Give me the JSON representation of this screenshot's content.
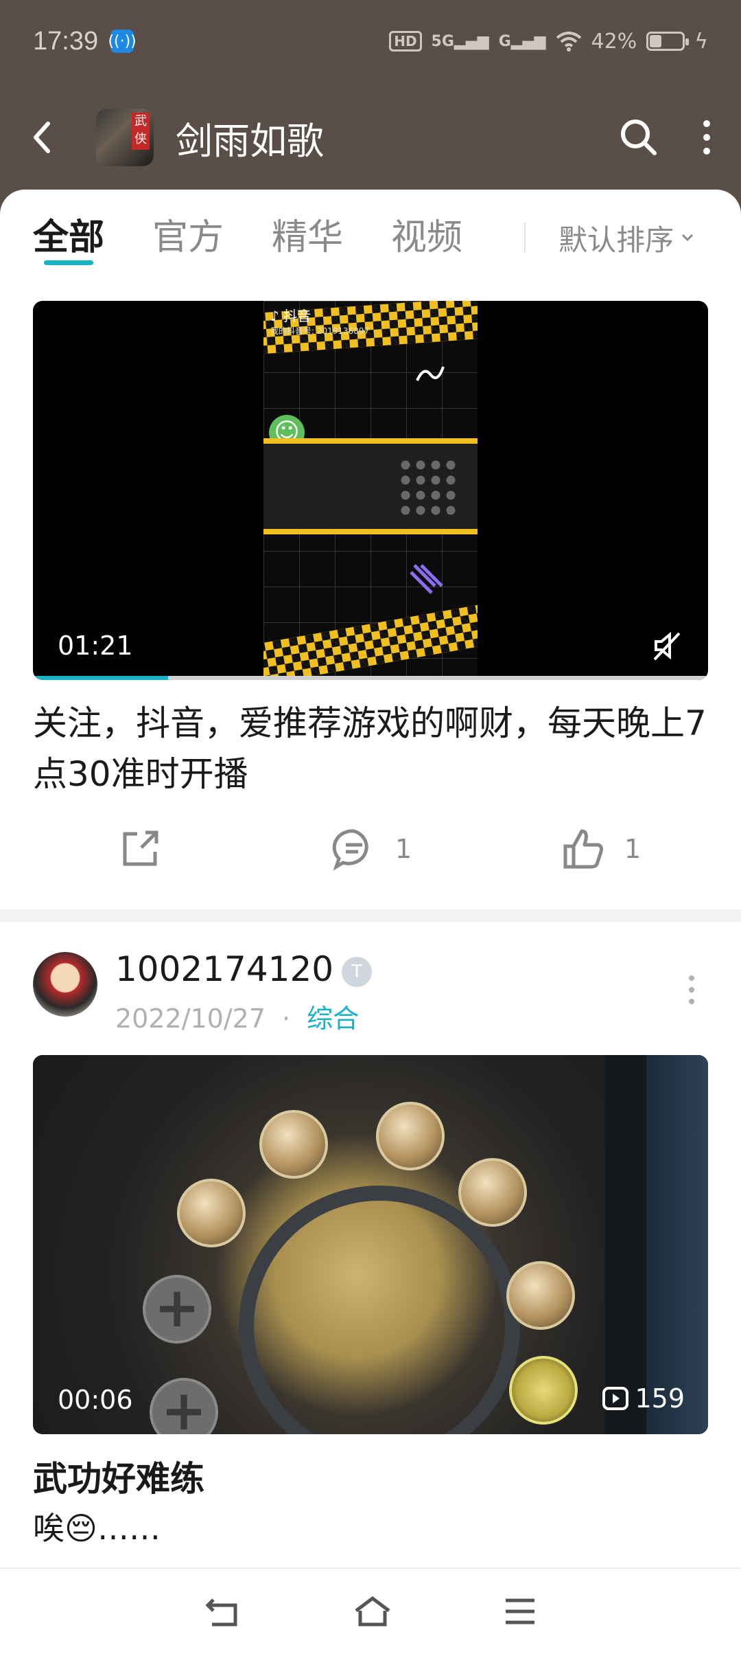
{
  "status_bar": {
    "time": "17:39",
    "hd_label": "HD",
    "network_1": "5G",
    "network_2": "G",
    "battery_percent": "42%",
    "battery_level": 0.42
  },
  "header": {
    "title": "剑雨如歌",
    "avatar_seal": "武侠"
  },
  "tabs": [
    {
      "label": "全部",
      "active": true
    },
    {
      "label": "官方",
      "active": false
    },
    {
      "label": "精华",
      "active": false
    },
    {
      "label": "视频",
      "active": false
    }
  ],
  "sort_label": "默认排序",
  "post_1": {
    "video": {
      "duration": "01:21",
      "progress": 0.2,
      "tiktok_label": "抖音",
      "tiktok_id": "我的抖音号: 2019136897"
    },
    "title": "关注，抖音，爱推荐游戏的啊财，每天晚上7点30准时开播",
    "comment_count": "1",
    "like_count": "1"
  },
  "post_2": {
    "author": "1002174120",
    "level_badge": "T",
    "date": "2022/10/27",
    "separator": "·",
    "category": "综合",
    "video": {
      "duration": "00:06",
      "views": "159"
    },
    "title": "武功好难练",
    "body": "唉😔……"
  },
  "colors": {
    "accent": "#19b3c6",
    "header_bg": "#5a4f48"
  },
  "icons": {
    "back": "chevron-left-icon",
    "search": "search-icon",
    "more": "more-vertical-icon",
    "share": "share-icon",
    "comment": "comment-icon",
    "like": "thumbs-up-icon",
    "mute": "mute-icon",
    "play_count": "play-count-icon",
    "nav_back": "nav-back-icon",
    "nav_home": "nav-home-icon",
    "nav_menu": "nav-menu-icon"
  }
}
